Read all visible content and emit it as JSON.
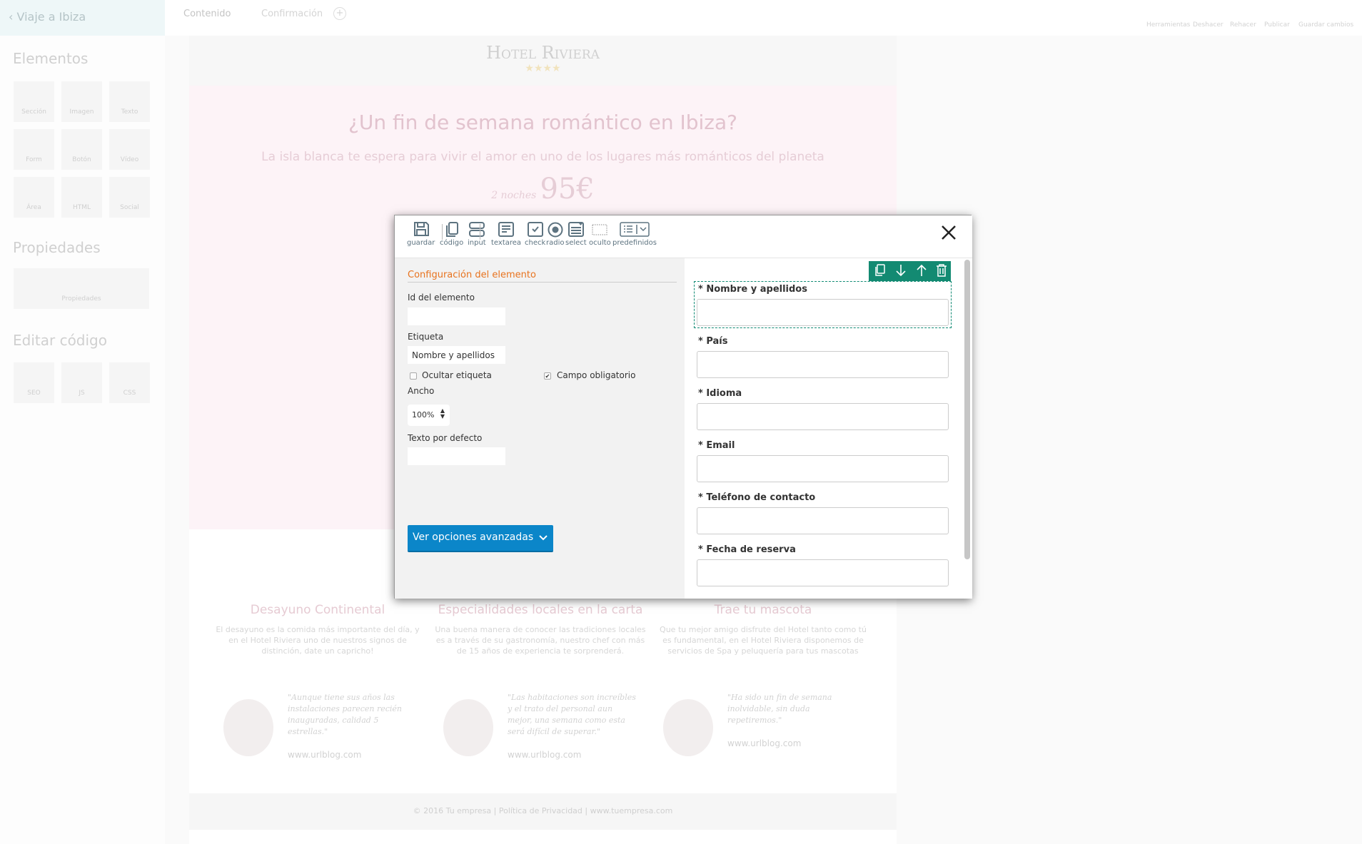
{
  "app": {
    "back_label": "Viaje a Ibiza",
    "tabs": [
      "Contenido",
      "Confirmación"
    ],
    "toolbar": [
      "Herramientas",
      "Deshacer",
      "Rehacer",
      "Publicar",
      "Guardar cambios"
    ]
  },
  "sidebar": {
    "elementos_title": "Elementos",
    "elementos": [
      "Sección",
      "Imagen",
      "Texto",
      "Form",
      "Botón",
      "Vídeo",
      "Área",
      "HTML",
      "Social"
    ],
    "propiedades_title": "Propiedades",
    "propiedades_button": "Propiedades",
    "codigo_title": "Editar código",
    "codigo": [
      "SEO",
      "JS",
      "CSS"
    ]
  },
  "page": {
    "hotel_name": "Hotel Riviera",
    "stars": "★★★★",
    "hero_title": "¿Un fin de semana romántico en Ibiza?",
    "hero_subtitle": "La isla blanca te espera para vivir el amor en uno de los lugares más románticos del planeta",
    "price_prefix": "2 noches",
    "price": "95€",
    "features": [
      {
        "title": "Desayuno Continental",
        "text": "El desayuno es la comida más importante del día, y en el Hotel Riviera uno de nuestros signos de distinción, date un capricho!"
      },
      {
        "title": "Especialidades locales en la carta",
        "text": "Una buena manera de conocer las tradiciones locales es a través de su gastronomía, nuestro chef con más de 15 años de experiencia te sorprenderá."
      },
      {
        "title": "Trae tu mascota",
        "text": "Que tu mejor amigo disfrute del Hotel tanto como tú es fundamental, en el Hotel Riviera disponemos de servicios de Spa y peluquería para tus mascotas"
      }
    ],
    "testimonials": [
      {
        "quote": "\"Aunque tiene sus años las instalaciones parecen recién inauguradas, calidad 5 estrellas.\"",
        "url": "www.urlblog.com"
      },
      {
        "quote": "\"Las habitaciones son increíbles y el trato del personal aun mejor, una semana como esta será difícil de superar.\"",
        "url": "www.urlblog.com"
      },
      {
        "quote": "\"Ha sido un fin de semana inolvidable, sin duda repetiremos.\"",
        "url": "www.urlblog.com"
      }
    ],
    "footer": "© 2016 Tu empresa | Política de Privacidad | www.tuempresa.com"
  },
  "modal": {
    "toolbar": [
      {
        "label": "guardar",
        "icon": "save-icon"
      },
      {
        "label": "código",
        "icon": "copy-icon"
      },
      {
        "label": "input",
        "icon": "input-icon"
      },
      {
        "label": "textarea",
        "icon": "textarea-icon"
      },
      {
        "label": "check",
        "icon": "check-icon"
      },
      {
        "label": "radio",
        "icon": "radio-icon"
      },
      {
        "label": "select",
        "icon": "select-icon"
      },
      {
        "label": "oculto",
        "icon": "hidden-icon"
      },
      {
        "label": "predefinidos",
        "icon": "list-dropdown-icon"
      }
    ],
    "config": {
      "title": "Configuración del elemento",
      "id_label": "Id del elemento",
      "id_value": "",
      "etiqueta_label": "Etiqueta",
      "etiqueta_value": "Nombre y apellidos",
      "ocultar_label": "Ocultar etiqueta",
      "ocultar_checked": false,
      "obligatorio_label": "Campo obligatorio",
      "obligatorio_checked": true,
      "ancho_label": "Ancho",
      "ancho_value": "100%",
      "texto_label": "Texto por defecto",
      "texto_value": "",
      "advanced_button": "Ver opciones avanzadas"
    },
    "form_fields": [
      {
        "label": "* Nombre y apellidos"
      },
      {
        "label": "* País"
      },
      {
        "label": "* Idioma"
      },
      {
        "label": "* Email"
      },
      {
        "label": "* Teléfono de contacto"
      },
      {
        "label": "* Fecha de reserva"
      }
    ],
    "colors": {
      "accent_orange": "#e8731e",
      "button_blue": "#0b86c9",
      "selection_green": "#138a72"
    }
  }
}
